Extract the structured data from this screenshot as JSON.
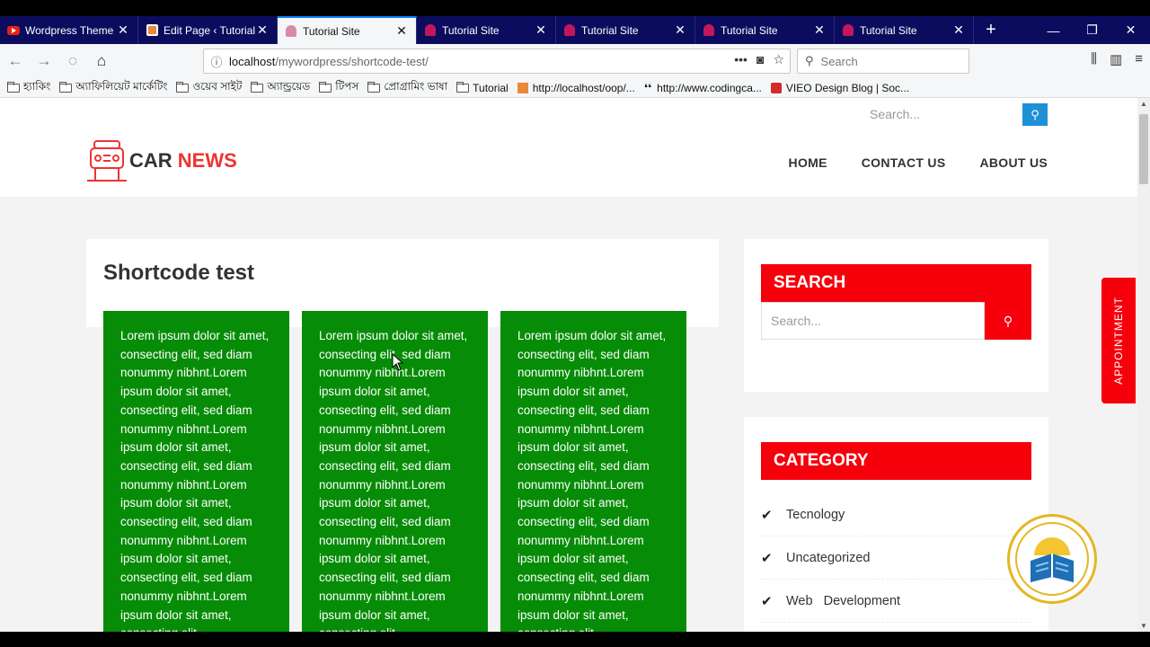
{
  "browser": {
    "tabs": [
      {
        "label": "Wordpress Theme D",
        "icon": "youtube-icon"
      },
      {
        "label": "Edit Page ‹ Tutorial",
        "icon": "wordpress-icon"
      },
      {
        "label": "Tutorial Site",
        "icon": "site-icon",
        "active": true
      },
      {
        "label": "Tutorial Site",
        "icon": "site-icon"
      },
      {
        "label": "Tutorial Site",
        "icon": "site-icon"
      },
      {
        "label": "Tutorial Site",
        "icon": "site-icon"
      },
      {
        "label": "Tutorial Site",
        "icon": "site-icon"
      }
    ],
    "url_host": "localhost",
    "url_path": "/mywordpress/shortcode-test/",
    "search_placeholder": "Search",
    "bookmarks": [
      {
        "label": "হ্যাকিং",
        "icon": "folder-icon"
      },
      {
        "label": "অ্যাফিলিয়েট মার্কেটিং",
        "icon": "folder-icon"
      },
      {
        "label": "ওয়েব সাইট",
        "icon": "folder-icon"
      },
      {
        "label": "অ্যান্ড্রয়েড",
        "icon": "folder-icon"
      },
      {
        "label": "টিপস",
        "icon": "folder-icon"
      },
      {
        "label": "প্রোগ্রামিং ভাষা",
        "icon": "folder-icon"
      },
      {
        "label": "Tutorial",
        "icon": "folder-icon"
      },
      {
        "label": "http://localhost/oop/...",
        "icon": "page-icon"
      },
      {
        "label": "http://www.codingca...",
        "icon": "codingcage-icon"
      },
      {
        "label": "VIEO Design Blog | Soc...",
        "icon": "vieo-icon"
      }
    ]
  },
  "site": {
    "header_search_placeholder": "Search...",
    "logo_word1": "CAR",
    "logo_word2": "NEWS",
    "menu": [
      "HOME",
      "CONTACT US",
      "ABOUT US"
    ],
    "page_title": "Shortcode test",
    "column_text": "Lorem ipsum dolor sit amet, consecting elit, sed diam nonummy nibhnt.Lorem ipsum dolor sit amet, consecting elit, sed diam nonummy nibhnt.Lorem ipsum dolor sit amet, consecting elit, sed diam nonummy nibhnt.Lorem ipsum dolor sit amet, consecting elit, sed diam nonummy nibhnt.Lorem ipsum dolor sit amet, consecting elit, sed diam nonummy nibhnt.Lorem ipsum dolor sit amet, consecting elit,",
    "search_widget_title": "SEARCH",
    "search_widget_placeholder": "Search...",
    "category_title": "CATEGORY",
    "categories": [
      "Tecnology",
      "Uncategorized",
      "Web   Development"
    ],
    "appointment_label": "APPOINTMENT",
    "colors": {
      "accent_red": "#f5000b",
      "column_green": "#078c07",
      "search_blue": "#1e90d6"
    }
  }
}
